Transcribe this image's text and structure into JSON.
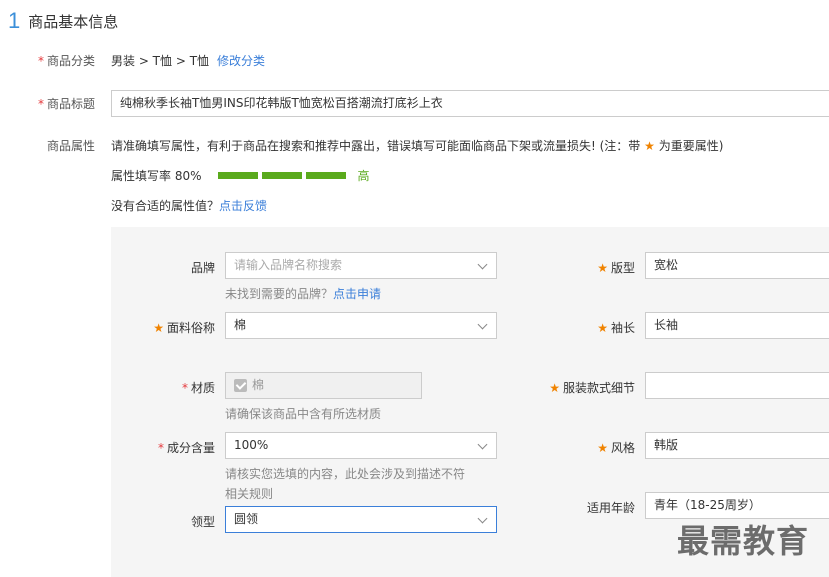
{
  "section": {
    "number": "1",
    "title": "商品基本信息"
  },
  "category": {
    "label": "商品分类",
    "path": "男装 > T恤 > T恤",
    "change_link": "修改分类"
  },
  "product_title": {
    "label": "商品标题",
    "value": "纯棉秋季长袖T恤男INS印花韩版T恤宽松百搭潮流打底衫上衣"
  },
  "attributes": {
    "label": "商品属性",
    "notice_before": "请准确填写属性，有利于商品在搜索和推荐中露出，错误填写可能面临商品下架或流量损失!   (注：带 ",
    "notice_after": " 为重要属性)",
    "fill_rate_label": "属性填写率 80%",
    "fill_rate": 80,
    "fill_level": "高",
    "feedback_text": "没有合适的属性值？",
    "feedback_link": "点击反馈"
  },
  "fields": {
    "brand": {
      "label": "品牌",
      "placeholder": "请输入品牌名称搜索",
      "hint_text": "未找到需要的品牌？",
      "hint_link": "点击申请"
    },
    "fabric": {
      "label": "面料俗称",
      "value": "棉"
    },
    "material": {
      "label": "材质",
      "value": "棉",
      "hint": "请确保该商品中含有所选材质"
    },
    "composition": {
      "label": "成分含量",
      "value": "100%",
      "hint_line1": "请核实您选填的内容，此处会涉及到描述不符",
      "hint_line2": "相关规则"
    },
    "collar": {
      "label": "领型",
      "value": "圆领"
    },
    "fit": {
      "label": "版型",
      "value": "宽松"
    },
    "sleeve": {
      "label": "袖长",
      "value": "长袖"
    },
    "detail": {
      "label": "服装款式细节",
      "value": ""
    },
    "style": {
      "label": "风格",
      "value": "韩版"
    },
    "age": {
      "label": "适用年龄",
      "value": "青年（18-25周岁）"
    }
  },
  "watermark": "最需教育",
  "colors": {
    "accent": "#3b7fd9",
    "progress": "#5aaa1c",
    "required": "#e4393c",
    "important_star": "#f08300"
  }
}
